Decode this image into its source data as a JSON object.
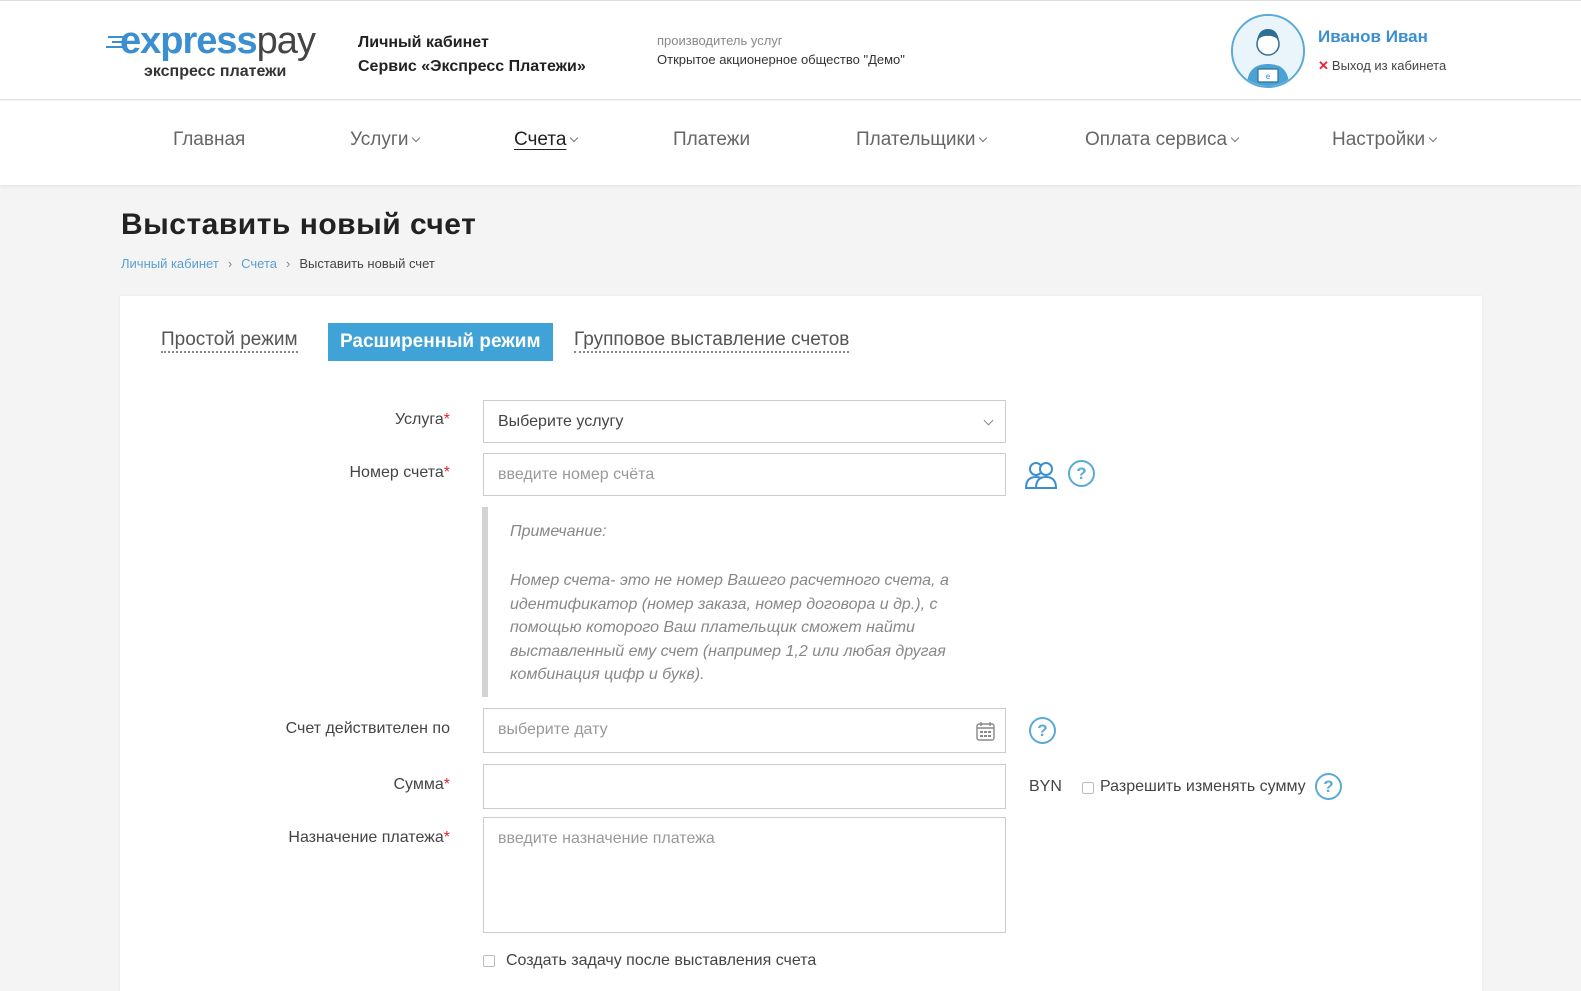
{
  "header": {
    "logo_primary": "express",
    "logo_secondary": "pay",
    "logo_subtitle": "экспресс платежи",
    "cabinet_title": "Личный кабинет",
    "service_title": "Сервис «Экспресс Платежи»",
    "provider_label": "производитель услуг",
    "provider_name": "Открытое акционерное общество \"Демо\"",
    "user_name": "Иванов Иван",
    "logout_label": "Выход из кабинета"
  },
  "nav": {
    "items": [
      {
        "label": "Главная"
      },
      {
        "label": "Услуги"
      },
      {
        "label": "Счета"
      },
      {
        "label": "Платежи"
      },
      {
        "label": "Плательщики"
      },
      {
        "label": "Оплата сервиса"
      },
      {
        "label": "Настройки"
      }
    ],
    "active_index": 2
  },
  "page": {
    "title": "Выставить новый счет",
    "breadcrumb": [
      "Личный кабинет",
      "Счета",
      "Выставить новый счет"
    ]
  },
  "tabs": [
    {
      "label": "Простой режим"
    },
    {
      "label": "Расширенный режим"
    },
    {
      "label": "Групповое выставление счетов"
    }
  ],
  "form": {
    "service_label": "Услуга",
    "service_value": "Выберите услугу",
    "account_label": "Номер счета",
    "account_placeholder": "введите номер счёта",
    "note_title": "Примечание:",
    "note_text": "Номер счета- это не номер Вашего расчетного счета, а идентификатор (номер заказа, номер договора и др.), с помощью которого Ваш плательщик сможет найти выставленный ему счет (например 1,2 или любая другая комбинация цифр и букв).",
    "valid_label": "Счет действителен по",
    "valid_placeholder": "выберите дату",
    "amount_label": "Сумма",
    "amount_value": "",
    "currency": "BYN",
    "allow_change_label": "Разрешить изменять сумму",
    "purpose_label": "Назначение платежа",
    "purpose_placeholder": "введите назначение платежа",
    "create_task_label": "Создать задачу после выставления счета",
    "required_mark": "*",
    "help_glyph": "?"
  },
  "colors": {
    "accent": "#3fa3d8",
    "brand_blue": "#3b8fd1",
    "required": "#e2262f"
  }
}
